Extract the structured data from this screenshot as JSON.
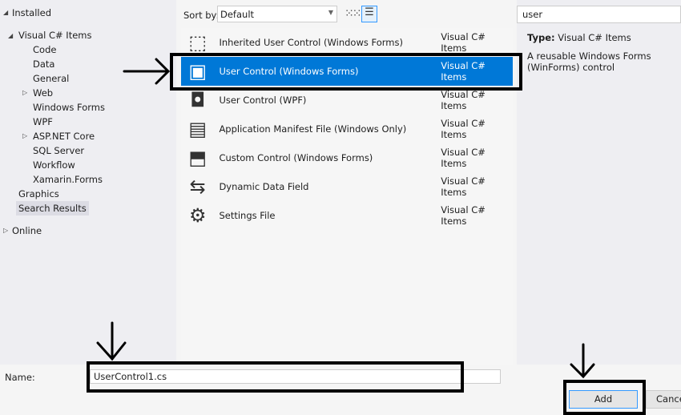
{
  "tree": {
    "installed": "Installed",
    "visual_cs": "Visual C# Items",
    "children": [
      "Code",
      "Data",
      "General",
      "Web",
      "Windows Forms",
      "WPF",
      "ASP.NET Core",
      "SQL Server",
      "Workflow",
      "Xamarin.Forms"
    ],
    "graphics": "Graphics",
    "search_results": "Search Results",
    "online": "Online"
  },
  "toolbar": {
    "sort_label": "Sort by:",
    "sort_value": "Default",
    "search_value": "user"
  },
  "items": [
    {
      "name": "Inherited User Control (Windows Forms)",
      "type": "Visual C# Items",
      "icon": "inherited-user-control-icon"
    },
    {
      "name": "User Control (Windows Forms)",
      "type": "Visual C# Items",
      "icon": "user-control-icon"
    },
    {
      "name": "User Control (WPF)",
      "type": "Visual C# Items",
      "icon": "wpf-user-control-icon"
    },
    {
      "name": "Application Manifest File (Windows Only)",
      "type": "Visual C# Items",
      "icon": "manifest-icon"
    },
    {
      "name": "Custom Control (Windows Forms)",
      "type": "Visual C# Items",
      "icon": "custom-control-icon"
    },
    {
      "name": "Dynamic Data Field",
      "type": "Visual C# Items",
      "icon": "dynamic-data-icon"
    },
    {
      "name": "Settings File",
      "type": "Visual C# Items",
      "icon": "settings-gear-icon"
    }
  ],
  "details": {
    "type_label": "Type:",
    "type_value": "Visual C# Items",
    "description": "A reusable Windows Forms (WinForms) control"
  },
  "footer": {
    "name_label": "Name:",
    "name_value": "UserControl1.cs",
    "add": "Add",
    "cancel": "Cancel"
  },
  "colors": {
    "selected": "#0078d7"
  }
}
